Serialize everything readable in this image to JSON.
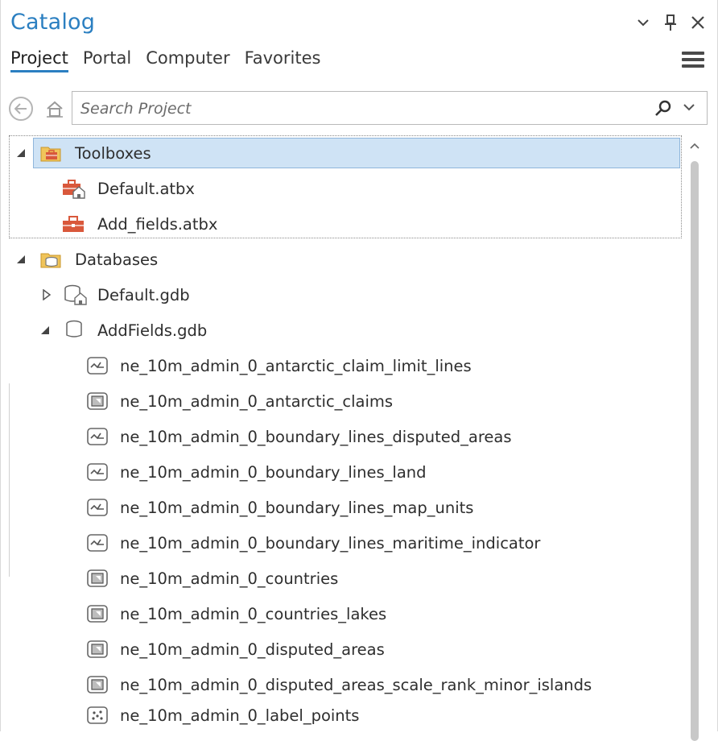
{
  "window": {
    "title": "Catalog",
    "buttons": [
      "chevron-down",
      "pin",
      "close"
    ]
  },
  "tabs": [
    {
      "label": "Project",
      "active": true
    },
    {
      "label": "Portal",
      "active": false
    },
    {
      "label": "Computer",
      "active": false
    },
    {
      "label": "Favorites",
      "active": false
    }
  ],
  "search": {
    "placeholder": "Search Project"
  },
  "colors": {
    "accent": "#2b7fc1",
    "selection": "#cfe3f5",
    "toolbox": "#d9583b",
    "folder": "#e8b84a"
  },
  "tree": [
    {
      "label": "Toolboxes",
      "icon": "toolboxes-folder-icon",
      "expanded": true,
      "selected": true,
      "level": 0
    },
    {
      "label": "Default.atbx",
      "icon": "default-toolbox-icon",
      "level": 1
    },
    {
      "label": "Add_fields.atbx",
      "icon": "toolbox-icon",
      "level": 1
    },
    {
      "label": "Databases",
      "icon": "databases-folder-icon",
      "expanded": true,
      "level": 0
    },
    {
      "label": "Default.gdb",
      "icon": "default-geodatabase-icon",
      "expanded": false,
      "level": 1
    },
    {
      "label": "AddFields.gdb",
      "icon": "geodatabase-icon",
      "expanded": true,
      "level": 1
    },
    {
      "label": "ne_10m_admin_0_antarctic_claim_limit_lines",
      "icon": "line-feature-class-icon",
      "level": 2
    },
    {
      "label": "ne_10m_admin_0_antarctic_claims",
      "icon": "polygon-feature-class-icon",
      "level": 2
    },
    {
      "label": "ne_10m_admin_0_boundary_lines_disputed_areas",
      "icon": "line-feature-class-icon",
      "level": 2
    },
    {
      "label": "ne_10m_admin_0_boundary_lines_land",
      "icon": "line-feature-class-icon",
      "level": 2
    },
    {
      "label": "ne_10m_admin_0_boundary_lines_map_units",
      "icon": "line-feature-class-icon",
      "level": 2
    },
    {
      "label": "ne_10m_admin_0_boundary_lines_maritime_indicator",
      "icon": "line-feature-class-icon",
      "level": 2
    },
    {
      "label": "ne_10m_admin_0_countries",
      "icon": "polygon-feature-class-icon",
      "level": 2
    },
    {
      "label": "ne_10m_admin_0_countries_lakes",
      "icon": "polygon-feature-class-icon",
      "level": 2
    },
    {
      "label": "ne_10m_admin_0_disputed_areas",
      "icon": "polygon-feature-class-icon",
      "level": 2
    },
    {
      "label": "ne_10m_admin_0_disputed_areas_scale_rank_minor_islands",
      "icon": "polygon-feature-class-icon",
      "level": 2
    },
    {
      "label": "ne_10m_admin_0_label_points",
      "icon": "point-feature-class-icon",
      "level": 2
    }
  ]
}
